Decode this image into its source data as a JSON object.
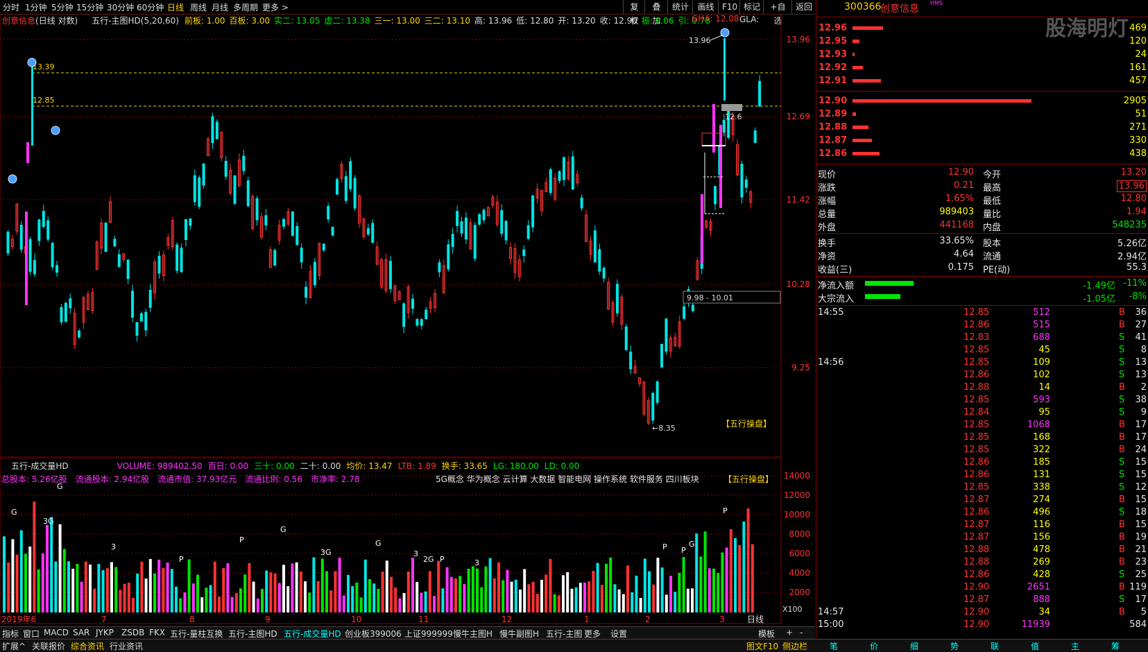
{
  "toolbar": {
    "periods": [
      "分时",
      "1分钟",
      "5分钟",
      "15分钟",
      "30分钟",
      "60分钟",
      "日线",
      "周线",
      "月线",
      "多周期",
      "更多 >"
    ],
    "active_period": "日线",
    "right_buttons": [
      "复权",
      "叠加",
      "统计",
      "画线",
      "F10",
      "标记",
      "+自选",
      "返回"
    ]
  },
  "chart_header": {
    "stock_name": "创意信息",
    "mode": "(日线 对数)",
    "indicator": "五行-主图HD(5,20,60)",
    "items": [
      {
        "label": "前板:",
        "value": "1.00",
        "color": "#ffd400"
      },
      {
        "label": "百板:",
        "value": "3.00",
        "color": "#ffd400"
      },
      {
        "label": "实二:",
        "value": "13.05",
        "color": "#00e600"
      },
      {
        "label": "虚二:",
        "value": "13.38",
        "color": "#00e600"
      },
      {
        "label": "三一:",
        "value": "13.00",
        "color": "#ffd400"
      },
      {
        "label": "三二:",
        "value": "13.10",
        "color": "#ffd400"
      },
      {
        "label": "高:",
        "value": "13.96",
        "color": "#ddd"
      },
      {
        "label": "低:",
        "value": "12.80",
        "color": "#ddd"
      },
      {
        "label": "开:",
        "value": "13.20",
        "color": "#ddd"
      },
      {
        "label": "收:",
        "value": "12.90",
        "color": "#ddd"
      },
      {
        "label": "振:",
        "value": "9.06",
        "color": "#00e600"
      },
      {
        "label": "引:",
        "value": "0.78",
        "color": "#00e600"
      }
    ],
    "gha": "GHA: 12.08",
    "gla": "GLA:"
  },
  "price_axis": [
    "13.96",
    "12.69",
    "11.42",
    "10.28",
    "9.25"
  ],
  "price_labels": {
    "high_mark": "13.96",
    "low_mark": "8.35",
    "left_high": "13.39",
    "left_12": "12.85",
    "range_box": "9.98 - 10.01",
    "right_12": "12.6",
    "brand": "【五行操盘】"
  },
  "volume_header": {
    "indicator": "五行-成交量HD",
    "items": [
      {
        "text": "VOLUME: 989402.50",
        "color": "#ff33ff"
      },
      {
        "text": "百日: 0.00",
        "color": "#ff33ff"
      },
      {
        "text": "三十: 0.00",
        "color": "#00e600"
      },
      {
        "text": "二十: 0.00",
        "color": "#ddd"
      },
      {
        "text": "均价: 13.47",
        "color": "#ffd400"
      },
      {
        "text": "LTB: 1.89",
        "color": "#ff3232"
      },
      {
        "text": "换手: 33.65",
        "color": "#ffd400"
      },
      {
        "text": "LG: 180.00",
        "color": "#00e600"
      },
      {
        "text": "LD: 0.00",
        "color": "#00e600"
      }
    ],
    "line2": [
      {
        "text": "总股本: 5.26亿股",
        "color": "#ff33ff"
      },
      {
        "text": "流通股本: 2.94亿股",
        "color": "#ff33ff"
      },
      {
        "text": "流通市值: 37.93亿元",
        "color": "#ff33ff"
      },
      {
        "text": "流通比例: 0.56",
        "color": "#ff33ff"
      },
      {
        "text": "市净率: 2.78",
        "color": "#ff33ff"
      }
    ],
    "concepts": "5G概念 华为概念 云计算 大数据 智能电网 操作系统    软件服务   四川板块",
    "brand": "【五行操盘】",
    "unit": "X100"
  },
  "volume_axis": [
    "14000",
    "12000",
    "10000",
    "8000",
    "6000",
    "4000",
    "2000"
  ],
  "time_axis": [
    "2019年6",
    "7",
    "8",
    "9",
    "10",
    "11",
    "12",
    "1",
    "2",
    "3"
  ],
  "bottom_tabs": [
    "指标",
    "窗口",
    "MACD",
    "SAR",
    "JYKP",
    "ZSDB",
    "FKX",
    "五行-量柱互换",
    "五行-主图HD",
    "五行-成交量HD",
    "创业板399006",
    "上证999999",
    "慢牛主图H",
    "慢牛副图H",
    "五行-主图",
    "更多",
    "设置"
  ],
  "active_tab": "五行-成交量HD",
  "bottom_right_tabs": [
    "模板",
    "+",
    "-"
  ],
  "status_left": [
    "扩展^",
    "关联报价",
    "综合资讯",
    "行业资讯"
  ],
  "status_right": [
    "图文F10",
    "侧边栏"
  ],
  "status_panel_tabs": [
    "笔",
    "价",
    "细",
    "势",
    "联",
    "值",
    "主",
    "筹"
  ],
  "quote": {
    "code": "300366",
    "name": "创意信息",
    "badge": "HMS",
    "watermark": "股海明灯",
    "sell": [
      {
        "price": "12.96",
        "vol": "469",
        "bar": 0.17
      },
      {
        "price": "12.95",
        "vol": "120",
        "bar": 0.04
      },
      {
        "price": "12.93",
        "vol": "24",
        "bar": 0.01
      },
      {
        "price": "12.92",
        "vol": "161",
        "bar": 0.06
      },
      {
        "price": "12.91",
        "vol": "457",
        "bar": 0.16
      }
    ],
    "buy": [
      {
        "price": "12.90",
        "vol": "2905",
        "bar": 1.0
      },
      {
        "price": "12.89",
        "vol": "51",
        "bar": 0.02
      },
      {
        "price": "12.88",
        "vol": "271",
        "bar": 0.09
      },
      {
        "price": "12.87",
        "vol": "330",
        "bar": 0.11
      },
      {
        "price": "12.86",
        "vol": "438",
        "bar": 0.15
      }
    ],
    "stats": [
      {
        "l1": "现价",
        "v1": "12.90",
        "c1": "#ff3232",
        "l2": "今开",
        "v2": "13.20",
        "c2": "#ff3232"
      },
      {
        "l1": "涨跌",
        "v1": "0.21",
        "c1": "#ff3232",
        "l2": "最高",
        "v2": "13.96",
        "c2": "#ff3232"
      },
      {
        "l1": "涨幅",
        "v1": "1.65%",
        "c1": "#ff3232",
        "l2": "最低",
        "v2": "12.80",
        "c2": "#ff3232"
      },
      {
        "l1": "总量",
        "v1": "989403",
        "c1": "#ffff00",
        "l2": "量比",
        "v2": "1.94",
        "c2": "#ff3232"
      },
      {
        "l1": "外盘",
        "v1": "441168",
        "c1": "#ff3232",
        "l2": "内盘",
        "v2": "548235",
        "c2": "#00e600"
      }
    ],
    "stats2": [
      {
        "l1": "换手",
        "v1": "33.65%",
        "l2": "股本",
        "v2": "5.26亿"
      },
      {
        "l1": "净资",
        "v1": "4.64",
        "l2": "流通",
        "v2": "2.94亿"
      },
      {
        "l1": "收益(三)",
        "v1": "0.175",
        "l2": "PE(动)",
        "v2": "55.3"
      }
    ],
    "flows": [
      {
        "label": "净流入额",
        "bar": 0.55,
        "value": "-1.49亿",
        "pct": "-11%"
      },
      {
        "label": "大宗流入",
        "bar": 0.4,
        "value": "-1.05亿",
        "pct": "-8%"
      }
    ]
  },
  "ticks": [
    {
      "time": "14:55",
      "price": "12.85",
      "vol": "512",
      "side": "B",
      "n": "36"
    },
    {
      "time": "",
      "price": "12.86",
      "vol": "515",
      "side": "B",
      "n": "27"
    },
    {
      "time": "",
      "price": "12.83",
      "vol": "688",
      "side": "S",
      "n": "41"
    },
    {
      "time": "",
      "price": "12.85",
      "vol": "45",
      "side": "S",
      "n": "8"
    },
    {
      "time": "14:56",
      "price": "12.85",
      "vol": "109",
      "side": "S",
      "n": "13"
    },
    {
      "time": "",
      "price": "12.86",
      "vol": "102",
      "side": "S",
      "n": "13"
    },
    {
      "time": "",
      "price": "12.88",
      "vol": "14",
      "side": "B",
      "n": "2"
    },
    {
      "time": "",
      "price": "12.85",
      "vol": "593",
      "side": "S",
      "n": "38"
    },
    {
      "time": "",
      "price": "12.84",
      "vol": "95",
      "side": "S",
      "n": "9"
    },
    {
      "time": "",
      "price": "12.85",
      "vol": "1068",
      "side": "B",
      "n": "17"
    },
    {
      "time": "",
      "price": "12.85",
      "vol": "168",
      "side": "B",
      "n": "17"
    },
    {
      "time": "",
      "price": "12.85",
      "vol": "322",
      "side": "B",
      "n": "24"
    },
    {
      "time": "",
      "price": "12.86",
      "vol": "185",
      "side": "S",
      "n": "15"
    },
    {
      "time": "",
      "price": "12.86",
      "vol": "131",
      "side": "S",
      "n": "15"
    },
    {
      "time": "",
      "price": "12.85",
      "vol": "338",
      "side": "S",
      "n": "12"
    },
    {
      "time": "",
      "price": "12.87",
      "vol": "274",
      "side": "B",
      "n": "15"
    },
    {
      "time": "",
      "price": "12.86",
      "vol": "496",
      "side": "S",
      "n": "18"
    },
    {
      "time": "",
      "price": "12.87",
      "vol": "116",
      "side": "B",
      "n": "15"
    },
    {
      "time": "",
      "price": "12.87",
      "vol": "156",
      "side": "B",
      "n": "19"
    },
    {
      "time": "",
      "price": "12.88",
      "vol": "478",
      "side": "B",
      "n": "21"
    },
    {
      "time": "",
      "price": "12.88",
      "vol": "269",
      "side": "B",
      "n": "23"
    },
    {
      "time": "",
      "price": "12.86",
      "vol": "428",
      "side": "S",
      "n": "25"
    },
    {
      "time": "",
      "price": "12.90",
      "vol": "2651",
      "side": "B",
      "n": "119"
    },
    {
      "time": "",
      "price": "12.87",
      "vol": "888",
      "side": "S",
      "n": "17"
    },
    {
      "time": "14:57",
      "price": "12.90",
      "vol": "34",
      "side": "B",
      "n": "5"
    },
    {
      "time": "15:00",
      "price": "12.90",
      "vol": "11939",
      "side": "",
      "n": "584"
    }
  ]
}
